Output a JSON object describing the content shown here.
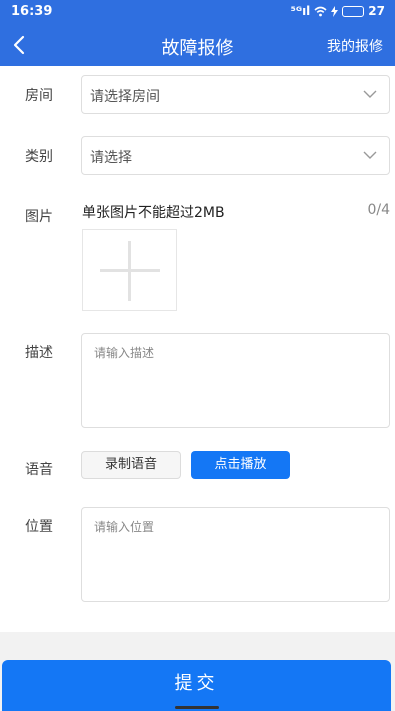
{
  "status_bar": {
    "time": "16:39",
    "signal": "⁵ᴳıl",
    "battery": "27"
  },
  "header": {
    "title": "故障报修",
    "right_link": "我的报修"
  },
  "form": {
    "room": {
      "label": "房间",
      "value": "请选择房间"
    },
    "category": {
      "label": "类别",
      "value": "请选择"
    },
    "picture": {
      "label": "图片",
      "hint": "单张图片不能超过2MB",
      "count": "0/4"
    },
    "description": {
      "label": "描述",
      "placeholder": "请输入描述"
    },
    "voice": {
      "label": "语音",
      "record_button": "录制语音",
      "play_button": "点击播放"
    },
    "location": {
      "label": "位置",
      "placeholder": "请输入位置"
    }
  },
  "submit_label": "提交",
  "colors": {
    "primary": "#2f6fe0",
    "accent_button": "#1477f5"
  }
}
